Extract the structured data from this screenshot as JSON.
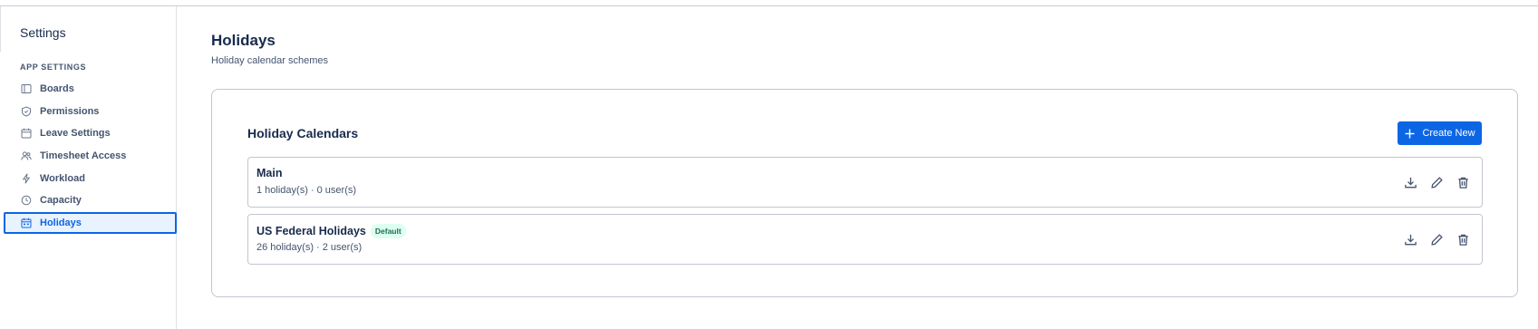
{
  "sidebar": {
    "title": "Settings",
    "section_label": "APP SETTINGS",
    "items": [
      {
        "label": "Boards",
        "icon": "board-icon"
      },
      {
        "label": "Permissions",
        "icon": "shield-icon"
      },
      {
        "label": "Leave Settings",
        "icon": "calendar-icon"
      },
      {
        "label": "Timesheet Access",
        "icon": "people-icon"
      },
      {
        "label": "Workload",
        "icon": "lightning-icon"
      },
      {
        "label": "Capacity",
        "icon": "clock-icon"
      },
      {
        "label": "Holidays",
        "icon": "calendar-event-icon",
        "active": true
      }
    ]
  },
  "header": {
    "title": "Holidays",
    "subtitle": "Holiday calendar schemes"
  },
  "panel": {
    "title": "Holiday Calendars",
    "create_label": "Create New",
    "calendars": [
      {
        "name": "Main",
        "meta": "1 holiday(s) · 0 user(s)",
        "badge": ""
      },
      {
        "name": "US Federal Holidays",
        "meta": "26 holiday(s) · 2 user(s)",
        "badge": "Default"
      }
    ]
  },
  "colors": {
    "accent": "#0c66e4",
    "badge_bg": "#dcfff1",
    "badge_text": "#216e4e"
  }
}
